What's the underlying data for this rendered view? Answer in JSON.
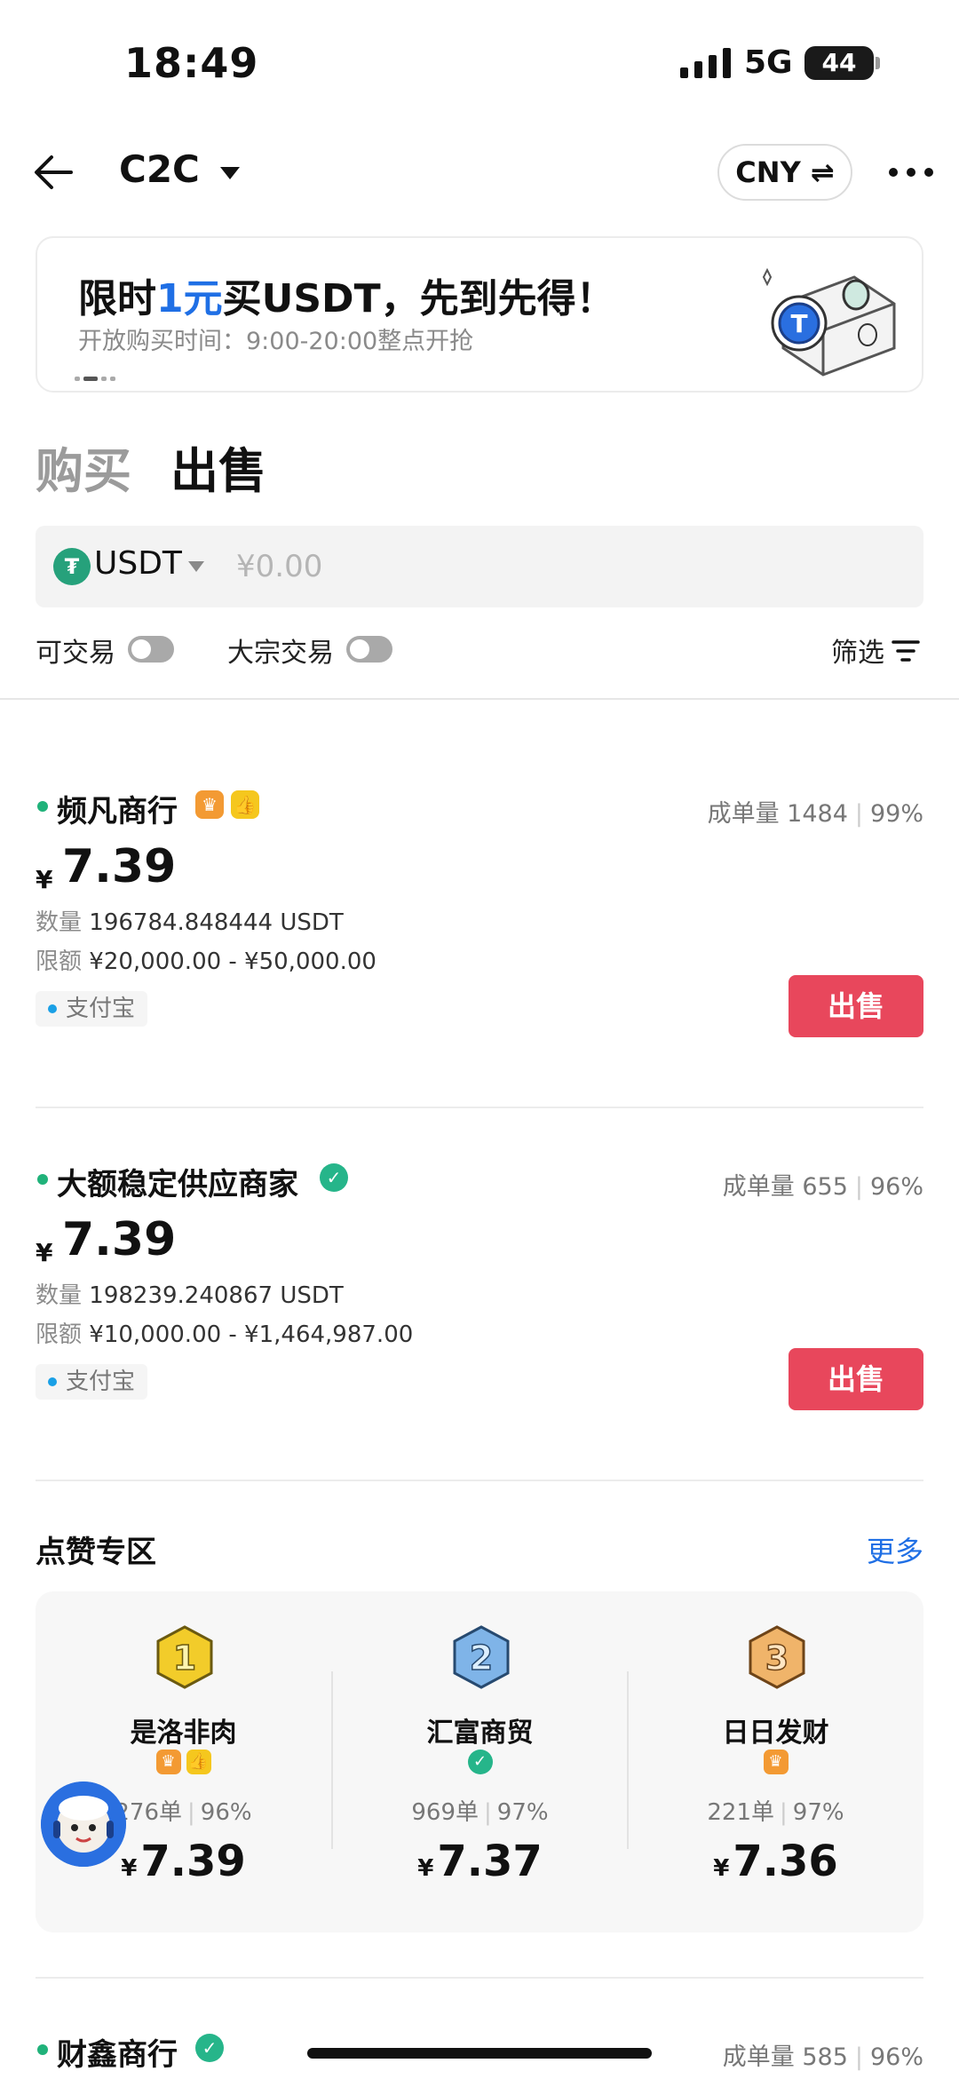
{
  "status_bar": {
    "time": "18:49",
    "network": "5G",
    "battery": "44"
  },
  "nav": {
    "title": "C2C",
    "currency_button": "CNY ⇌"
  },
  "banner": {
    "title_prefix": "限时",
    "title_highlight": "1元",
    "title_suffix": "买USDT，先到先得！",
    "subtitle": "开放购买时间：9:00-20:00整点开抢"
  },
  "tabs": {
    "buy": "购买",
    "sell": "出售"
  },
  "search": {
    "coin": "USDT",
    "amount_placeholder": "¥0.00",
    "amount_value": ""
  },
  "filters": {
    "tradable": "可交易",
    "bulk": "大宗交易",
    "filter": "筛选"
  },
  "listings": [
    {
      "name": "频凡商行",
      "orders": "成单量 1484",
      "rate": "99%",
      "currency": "¥",
      "price": "7.39",
      "qty_label": "数量",
      "qty": "196784.848444 USDT",
      "limit_label": "限额",
      "limit": "¥20,000.00 - ¥50,000.00",
      "payment": "支付宝",
      "action": "出售"
    },
    {
      "name": "大额稳定供应商家",
      "orders": "成单量 655",
      "rate": "96%",
      "currency": "¥",
      "price": "7.39",
      "qty_label": "数量",
      "qty": "198239.240867 USDT",
      "limit_label": "限额",
      "limit": "¥10,000.00 - ¥1,464,987.00",
      "payment": "支付宝",
      "action": "出售"
    },
    {
      "name": "财鑫商行",
      "orders": "成单量 585",
      "rate": "96%"
    }
  ],
  "likes_zone": {
    "title": "点赞专区",
    "more": "更多",
    "items": [
      {
        "rank": "1",
        "name": "是洛非肉",
        "orders": "276单",
        "rate": "96%",
        "currency": "¥",
        "price": "7.39",
        "rank_color": "#f2cc2a"
      },
      {
        "rank": "2",
        "name": "汇富商贸",
        "orders": "969单",
        "rate": "97%",
        "currency": "¥",
        "price": "7.37",
        "rank_color": "#7fb4e8"
      },
      {
        "rank": "3",
        "name": "日日发财",
        "orders": "221单",
        "rate": "97%",
        "currency": "¥",
        "price": "7.36",
        "rank_color": "#f0b46a"
      }
    ]
  },
  "colors": {
    "accent_blue": "#1f6fe5",
    "sell_red": "#e8475c",
    "online_green": "#20b27a"
  }
}
